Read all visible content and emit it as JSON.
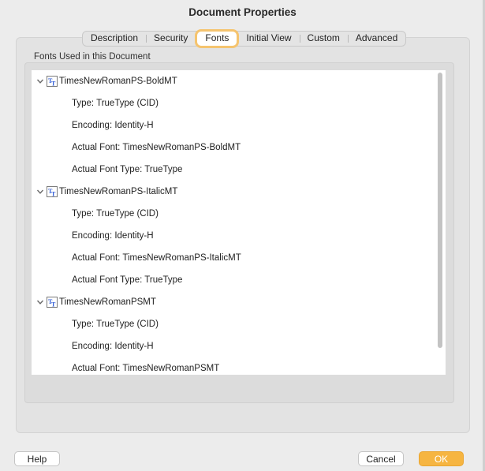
{
  "window": {
    "title": "Document Properties"
  },
  "tabs": [
    {
      "label": "Description",
      "active": false
    },
    {
      "label": "Security",
      "active": false
    },
    {
      "label": "Fonts",
      "active": true
    },
    {
      "label": "Initial View",
      "active": false
    },
    {
      "label": "Custom",
      "active": false
    },
    {
      "label": "Advanced",
      "active": false
    }
  ],
  "fonts_section": {
    "label": "Fonts Used in this Document",
    "fonts": [
      {
        "name": "TimesNewRomanPS-BoldMT",
        "icon": "truetype-font-icon",
        "expanded": true,
        "properties": [
          "Type: TrueType (CID)",
          "Encoding: Identity-H",
          "Actual Font: TimesNewRomanPS-BoldMT",
          "Actual Font Type: TrueType"
        ]
      },
      {
        "name": "TimesNewRomanPS-ItalicMT",
        "icon": "truetype-font-icon",
        "expanded": true,
        "properties": [
          "Type: TrueType (CID)",
          "Encoding: Identity-H",
          "Actual Font: TimesNewRomanPS-ItalicMT",
          "Actual Font Type: TrueType"
        ]
      },
      {
        "name": "TimesNewRomanPSMT",
        "icon": "truetype-font-icon",
        "expanded": true,
        "properties": [
          "Type: TrueType (CID)",
          "Encoding: Identity-H",
          "Actual Font: TimesNewRomanPSMT"
        ]
      }
    ]
  },
  "buttons": {
    "help": "Help",
    "cancel": "Cancel",
    "ok": "OK"
  },
  "colors": {
    "accent": "#f6b541",
    "active_tab_ring": "#f5c46f",
    "font_icon_blue": "#2f5bd7"
  }
}
